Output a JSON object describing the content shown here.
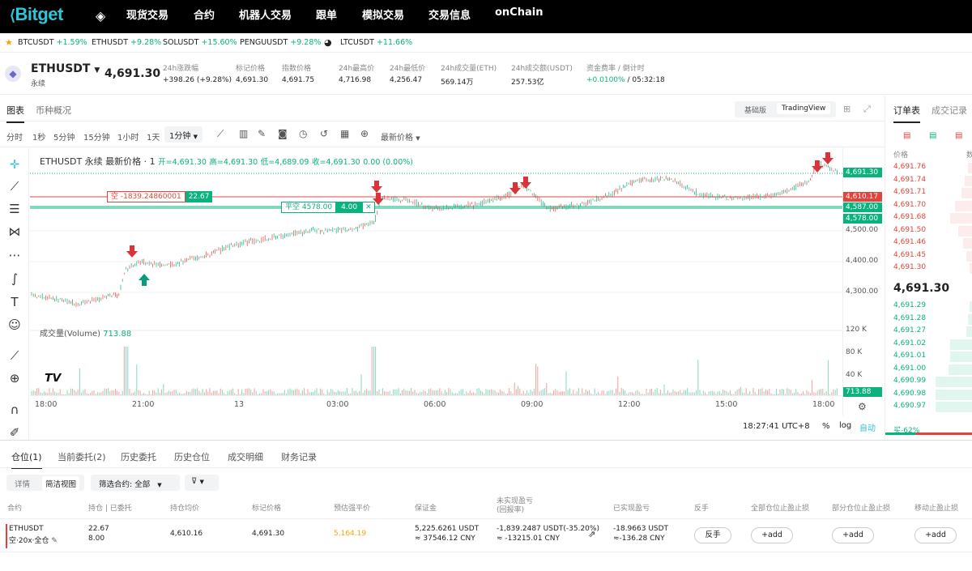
{
  "nav": {
    "logo": "Bitget",
    "items": [
      "现货交易",
      "合约",
      "机器人交易",
      "跟单",
      "模拟交易",
      "交易信息",
      "onChain"
    ]
  },
  "ticker": [
    {
      "sym": "BTCUSDT",
      "chg": "+1.59%"
    },
    {
      "sym": "ETHUSDT",
      "chg": "+9.28%"
    },
    {
      "sym": "SOLUSDT",
      "chg": "+15.60%"
    },
    {
      "sym": "PENGUUSDT",
      "chg": "+9.28%"
    },
    {
      "sym": "LTCUSDT",
      "chg": "+11.66%"
    }
  ],
  "symbol": {
    "name": "ETHUSDT",
    "type": "永续",
    "price": "4,691.30"
  },
  "stats": [
    {
      "label": "24h涨跌幅",
      "value": "+398.26 (+9.28%)"
    },
    {
      "label": "标记价格",
      "value": "4,691.30"
    },
    {
      "label": "指数价格",
      "value": "4,691.75"
    },
    {
      "label": "24h最高价",
      "value": "4,716.98"
    },
    {
      "label": "24h最低价",
      "value": "4,256.47"
    },
    {
      "label": "24h成交量(ETH)",
      "value": "569.14万"
    },
    {
      "label": "24h成交额(USDT)",
      "value": "257.53亿"
    },
    {
      "label": "资金费率 / 倒计时",
      "value": "+0.0100%",
      "value2": "/ 05:32:18"
    }
  ],
  "chart_tabs": {
    "chart": "图表",
    "overview": "币种概况",
    "basic": "基础版",
    "tv": "TradingView"
  },
  "timeframes": [
    "分时",
    "1秒",
    "5分钟",
    "15分钟",
    "1小时",
    "1天",
    "1分钟"
  ],
  "latest_price_label": "最新价格",
  "legend": {
    "title": "ETHUSDT 永续 最新价格 · 1",
    "open": "开=4,691.30",
    "high": "高=4,691.30",
    "low": "低=4,689.09",
    "close": "收=4,691.30",
    "chg": "0.00 (0.00%)"
  },
  "short_line": {
    "label": "空 -1839.24860001",
    "qty": "22.67"
  },
  "close_line": {
    "label": "平空 4578.00",
    "qty": "4.00"
  },
  "price_tags": {
    "last": "4,691.30",
    "entry": "4,610.17",
    "p1": "4,587.00",
    "p2": "4,578.00"
  },
  "y_axis": [
    "4,500.00",
    "4,400.00",
    "4,300.00"
  ],
  "vol_axis": [
    "120 K",
    "80 K",
    "40 K"
  ],
  "volume": {
    "label": "成交量(Volume)",
    "value": "713.88"
  },
  "x_axis": [
    "18:00",
    "21:00",
    "13",
    "03:00",
    "06:00",
    "09:00",
    "12:00",
    "15:00",
    "18:00"
  ],
  "clock": "18:27:41 UTC+8",
  "pct": "%",
  "log": "log",
  "auto": "自动",
  "orderbook": {
    "tab1": "订单表",
    "tab2": "成交记录",
    "col": "价格",
    "col2": "数",
    "asks": [
      "4,691.76",
      "4,691.74",
      "4,691.71",
      "4,691.70",
      "4,691.68",
      "4,691.50",
      "4,691.46",
      "4,691.45",
      "4,691.30"
    ],
    "mid": "4,691.30",
    "bids": [
      "4,691.29",
      "4,691.28",
      "4,691.27",
      "4,691.02",
      "4,691.01",
      "4,691.00",
      "4,690.99",
      "4,690.98",
      "4,690.97"
    ],
    "ratio": "买-62%"
  },
  "bottom_tabs": [
    "仓位(1)",
    "当前委托(2)",
    "历史委托",
    "历史仓位",
    "成交明细",
    "财务记录"
  ],
  "views": {
    "detail": "详情",
    "simple": "简洁视图",
    "filter": "筛选合约: 全部"
  },
  "table_headers": [
    "合约",
    "持仓 | 已委托",
    "持仓均价",
    "标记价格",
    "预估强平价",
    "保证金",
    "未实现盈亏\n(回报率)",
    "已实现盈亏",
    "反手",
    "全部仓位止盈止损",
    "部分仓位止盈止损",
    "移动止盈止损"
  ],
  "position": {
    "sym": "ETHUSDT",
    "side": "空·20x·全仓",
    "size": "22.67",
    "pending": "8.00",
    "avg": "4,610.16",
    "mark": "4,691.30",
    "liq": "5,164.19",
    "margin1": "5,225.6261 USDT",
    "margin2": "≈ 37546.12 CNY",
    "upnl1": "-1,839.2487 USDT(-35.20%)",
    "upnl2": "≈ -13215.01 CNY",
    "rpnl1": "-18.9663 USDT",
    "rpnl2": "≈-136.28 CNY",
    "flip": "反手",
    "add": "+add"
  },
  "colors": {
    "up": "#0ab27d",
    "down": "#e2443b",
    "brand": "#2ec5d8"
  }
}
